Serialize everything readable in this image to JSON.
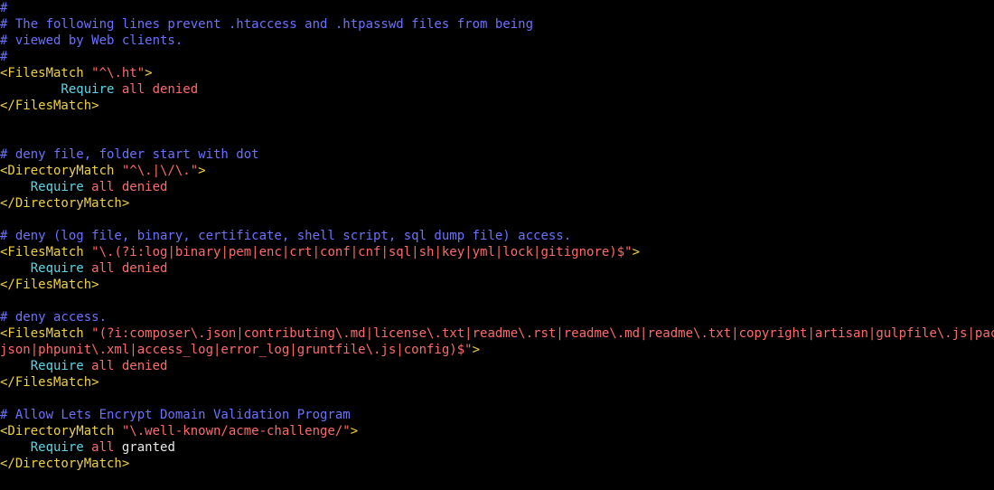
{
  "lines": [
    {
      "id": "l0",
      "segments": [
        {
          "cls": "comment",
          "text": "#"
        }
      ]
    },
    {
      "id": "l1",
      "segments": [
        {
          "cls": "comment",
          "text": "# The following lines prevent .htaccess and .htpasswd files from being"
        }
      ]
    },
    {
      "id": "l2",
      "segments": [
        {
          "cls": "comment",
          "text": "# viewed by Web clients."
        }
      ]
    },
    {
      "id": "l3",
      "segments": [
        {
          "cls": "comment",
          "text": "#"
        }
      ]
    },
    {
      "id": "l4",
      "segments": [
        {
          "cls": "tag",
          "text": "<FilesMatch "
        },
        {
          "cls": "str",
          "text": "\"^\\.ht\""
        },
        {
          "cls": "tag",
          "text": ">"
        }
      ]
    },
    {
      "id": "l5",
      "segments": [
        {
          "cls": "kw",
          "text": "        Require "
        },
        {
          "cls": "val",
          "text": "all denied"
        }
      ]
    },
    {
      "id": "l6",
      "segments": [
        {
          "cls": "tag",
          "text": "</FilesMatch>"
        }
      ]
    },
    {
      "id": "l7",
      "segments": []
    },
    {
      "id": "l8",
      "segments": []
    },
    {
      "id": "l9",
      "segments": [
        {
          "cls": "comment",
          "text": "# deny file, folder start with dot"
        }
      ]
    },
    {
      "id": "l10",
      "segments": [
        {
          "cls": "tag",
          "text": "<DirectoryMatch "
        },
        {
          "cls": "str",
          "text": "\"^\\.|\\/\\.\""
        },
        {
          "cls": "tag",
          "text": ">"
        }
      ]
    },
    {
      "id": "l11",
      "segments": [
        {
          "cls": "kw",
          "text": "    Require "
        },
        {
          "cls": "val",
          "text": "all denied"
        }
      ]
    },
    {
      "id": "l12",
      "segments": [
        {
          "cls": "tag",
          "text": "</DirectoryMatch>"
        }
      ]
    },
    {
      "id": "l13",
      "segments": []
    },
    {
      "id": "l14",
      "segments": [
        {
          "cls": "comment",
          "text": "# deny (log file, binary, certificate, shell script, sql dump file) access."
        }
      ]
    },
    {
      "id": "l15",
      "segments": [
        {
          "cls": "tag",
          "text": "<FilesMatch "
        },
        {
          "cls": "str",
          "text": "\"\\.(?i:log|binary|pem|enc|crt|conf|cnf|sql|sh|key|yml|lock|gitignore)$\""
        },
        {
          "cls": "tag",
          "text": ">"
        }
      ]
    },
    {
      "id": "l16",
      "segments": [
        {
          "cls": "kw",
          "text": "    Require "
        },
        {
          "cls": "val",
          "text": "all denied"
        }
      ]
    },
    {
      "id": "l17",
      "segments": [
        {
          "cls": "tag",
          "text": "</FilesMatch>"
        }
      ]
    },
    {
      "id": "l18",
      "segments": []
    },
    {
      "id": "l19",
      "segments": [
        {
          "cls": "comment",
          "text": "# deny access."
        }
      ]
    },
    {
      "id": "l20",
      "segments": [
        {
          "cls": "tag",
          "text": "<FilesMatch "
        },
        {
          "cls": "str",
          "text": "\"(?i:composer\\.json|contributing\\.md|license\\.txt|readme\\.rst|readme\\.md|readme\\.txt|copyright|artisan|gulpfile\\.js|package\\."
        }
      ]
    },
    {
      "id": "l21",
      "segments": [
        {
          "cls": "str",
          "text": "json|phpunit\\.xml|access_log|error_log|gruntfile\\.js|config)$\""
        },
        {
          "cls": "tag",
          "text": ">"
        }
      ]
    },
    {
      "id": "l22",
      "segments": [
        {
          "cls": "kw",
          "text": "    Require "
        },
        {
          "cls": "val",
          "text": "all denied"
        }
      ]
    },
    {
      "id": "l23",
      "segments": [
        {
          "cls": "tag",
          "text": "</FilesMatch>"
        }
      ]
    },
    {
      "id": "l24",
      "segments": []
    },
    {
      "id": "l25",
      "segments": [
        {
          "cls": "comment",
          "text": "# Allow Lets Encrypt Domain Validation Program"
        }
      ]
    },
    {
      "id": "l26",
      "segments": [
        {
          "cls": "tag",
          "text": "<DirectoryMatch "
        },
        {
          "cls": "str",
          "text": "\"\\.well-known/acme-challenge/\""
        },
        {
          "cls": "tag",
          "text": ">"
        }
      ]
    },
    {
      "id": "l27",
      "segments": [
        {
          "cls": "kw",
          "text": "    Require "
        },
        {
          "cls": "val",
          "text": "all "
        },
        {
          "cls": "granted",
          "text": "granted"
        }
      ]
    },
    {
      "id": "l28",
      "segments": [
        {
          "cls": "tag",
          "text": "</DirectoryMatch>"
        }
      ]
    }
  ],
  "colors": {
    "background": "#000000",
    "comment": "#6a72ff",
    "tag": "#f0d23c",
    "string": "#ff6a6a",
    "keyword": "#58d8e8",
    "plain": "#e8e8e8"
  }
}
